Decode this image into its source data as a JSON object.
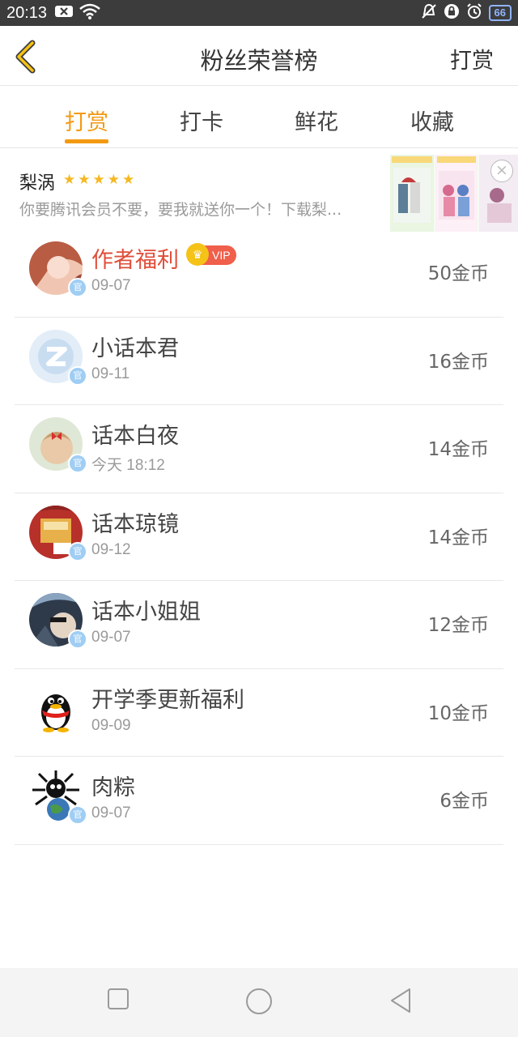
{
  "status_bar": {
    "time": "20:13",
    "battery": "66"
  },
  "header": {
    "title": "粉丝荣誉榜",
    "action": "打赏"
  },
  "tabs": [
    {
      "label": "打赏",
      "active": true
    },
    {
      "label": "打卡",
      "active": false
    },
    {
      "label": "鲜花",
      "active": false
    },
    {
      "label": "收藏",
      "active": false
    }
  ],
  "ad": {
    "title": "梨涡",
    "stars": "★★★★★",
    "description": "你要腾讯会员不要，要我就送你一个！下载梨..."
  },
  "fans": [
    {
      "name": "作者福利",
      "vip": true,
      "vip_label": "VIP",
      "date": "09-07",
      "coins": "50金币"
    },
    {
      "name": "小话本君",
      "vip": false,
      "date": "09-11",
      "coins": "16金币"
    },
    {
      "name": "话本白夜",
      "vip": false,
      "date": "今天 18:12",
      "coins": "14金币"
    },
    {
      "name": "话本琼镜",
      "vip": false,
      "date": "09-12",
      "coins": "14金币"
    },
    {
      "name": "话本小姐姐",
      "vip": false,
      "date": "09-07",
      "coins": "12金币"
    },
    {
      "name": "开学季更新福利",
      "vip": false,
      "date": "09-09",
      "coins": "10金币"
    },
    {
      "name": "肉粽",
      "vip": false,
      "date": "09-07",
      "coins": "6金币"
    }
  ],
  "colors": {
    "accent": "#f39a12",
    "vip_name": "#e04e3a",
    "status_bar": "#3c3c3c"
  }
}
